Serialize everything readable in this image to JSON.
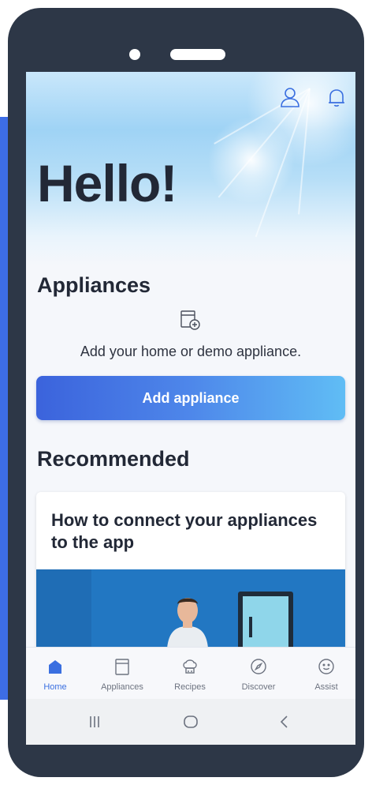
{
  "header": {
    "greeting": "Hello!",
    "icons": [
      "user-icon",
      "bell-icon"
    ]
  },
  "appliances": {
    "title": "Appliances",
    "empty_text": "Add your home or demo appliance.",
    "add_button_label": "Add appliance",
    "icon": "add-appliance-icon"
  },
  "recommended": {
    "title": "Recommended",
    "card_title": "How to connect your appliances to the app"
  },
  "tabs": [
    {
      "label": "Home",
      "icon": "home-icon",
      "active": true
    },
    {
      "label": "Appliances",
      "icon": "appliance-icon",
      "active": false
    },
    {
      "label": "Recipes",
      "icon": "chef-hat-icon",
      "active": false
    },
    {
      "label": "Discover",
      "icon": "compass-icon",
      "active": false
    },
    {
      "label": "Assist",
      "icon": "smiley-icon",
      "active": false
    }
  ],
  "system_nav": [
    "recent-apps-icon",
    "home-circle-icon",
    "back-icon"
  ],
  "colors": {
    "frame": "#2d3747",
    "accent": "#3a6fe0",
    "button_gradient_start": "#3b63dc",
    "button_gradient_end": "#60bdf5",
    "text_dark": "#222836"
  }
}
